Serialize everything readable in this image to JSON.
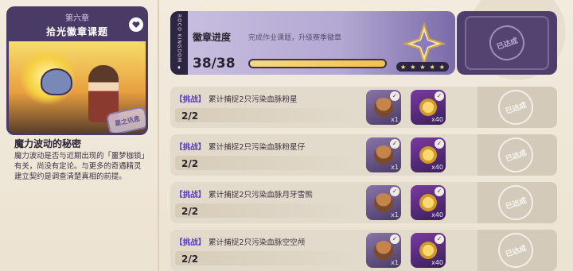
{
  "chapter": {
    "number": "第六章",
    "title": "拾光徽章课题",
    "stamp_text": "星之讯息",
    "heading": "魔力波动的秘密",
    "description": "魔力波动是否与近期出现的「噩梦枷锁」有关，尚没有定论。与更多的奇遇精灵建立契约是调查清楚真相的前提。"
  },
  "badge_progress": {
    "label": "徽章进度",
    "hint": "完成作业课题，升级赛季徽章",
    "count": "38/38",
    "progress_ratio": 1.0,
    "side_text": "ROCO KINGDOM ♦",
    "star_count": 5,
    "reward_status": "已达成"
  },
  "tasks": [
    {
      "tag": "【挑战】",
      "desc": "累计捕捉2只污染血脉粉星",
      "count": "2/2",
      "item1_qty": "x1",
      "item2_qty": "x40",
      "status": "已达成"
    },
    {
      "tag": "【挑战】",
      "desc": "累计捕捉2只污染血脉粉星仔",
      "count": "2/2",
      "item1_qty": "x1",
      "item2_qty": "x40",
      "status": "已达成"
    },
    {
      "tag": "【挑战】",
      "desc": "累计捕捉2只污染血脉月牙雪熊",
      "count": "2/2",
      "item1_qty": "x1",
      "item2_qty": "x40",
      "status": "已达成"
    },
    {
      "tag": "【挑战】",
      "desc": "累计捕捉2只污染血脉空空颅",
      "count": "2/2",
      "item1_qty": "x1",
      "item2_qty": "x40",
      "status": "已达成"
    }
  ],
  "icons": {
    "heart": "heart-icon",
    "check": "✓",
    "star": "★"
  }
}
